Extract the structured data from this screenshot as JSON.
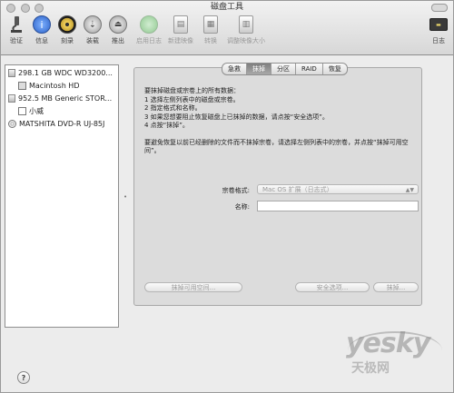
{
  "window": {
    "title": "磁盘工具"
  },
  "toolbar": {
    "items": [
      {
        "label": "验证",
        "icon": "microscope-icon",
        "enabled": true
      },
      {
        "label": "信息",
        "icon": "info-icon",
        "enabled": true
      },
      {
        "label": "刻录",
        "icon": "burn-icon",
        "enabled": true
      },
      {
        "label": "装载",
        "icon": "mount-icon",
        "enabled": true
      },
      {
        "label": "推出",
        "icon": "eject-icon",
        "enabled": true
      },
      {
        "label": "启用日志",
        "icon": "enable-journaling-icon",
        "enabled": false
      },
      {
        "label": "新建映像",
        "icon": "new-image-icon",
        "enabled": false
      },
      {
        "label": "转换",
        "icon": "convert-icon",
        "enabled": false
      },
      {
        "label": "调整映像大小",
        "icon": "resize-image-icon",
        "enabled": false
      },
      {
        "label": "日志",
        "icon": "log-icon",
        "enabled": true
      }
    ]
  },
  "sidebar": {
    "items": [
      {
        "label": "298.1 GB WDC WD3200...",
        "kind": "disk",
        "indent": 0
      },
      {
        "label": "Macintosh HD",
        "kind": "volume",
        "indent": 1
      },
      {
        "label": "952.5 MB Generic STOR...",
        "kind": "disk",
        "indent": 0
      },
      {
        "label": "小威",
        "kind": "volume",
        "indent": 1
      },
      {
        "label": "MATSHITA DVD-R UJ-85J",
        "kind": "optical",
        "indent": 0
      }
    ]
  },
  "tabs": [
    {
      "label": "急救",
      "active": false
    },
    {
      "label": "抹掉",
      "active": true
    },
    {
      "label": "分区",
      "active": false
    },
    {
      "label": "RAID",
      "active": false
    },
    {
      "label": "恢复",
      "active": false
    }
  ],
  "instructions": {
    "lines": [
      "要抹掉磁盘或宗卷上的所有数据：",
      "1  选择左侧列表中的磁盘或宗卷。",
      "2  指定格式和名称。",
      "3  如果您想要阻止恢复磁盘上已抹掉的数据，请点按“安全选项”。",
      "4  点按“抹掉”。"
    ],
    "note": "要避免恢复以前已经删除的文件而不抹掉宗卷，请选择左侧列表中的宗卷，并点按“抹掉可用空间”。"
  },
  "form": {
    "format_label": "宗卷格式:",
    "format_value": "Mac OS 扩展（日志式）",
    "name_label": "名称:",
    "name_value": ""
  },
  "buttons": {
    "erase_free_space": "抹掉可用空间...",
    "security_options": "安全选项...",
    "erase": "抹掉..."
  },
  "help": {
    "label": "?"
  },
  "watermark": {
    "brand": "yesky",
    "subtitle": "天极网"
  }
}
